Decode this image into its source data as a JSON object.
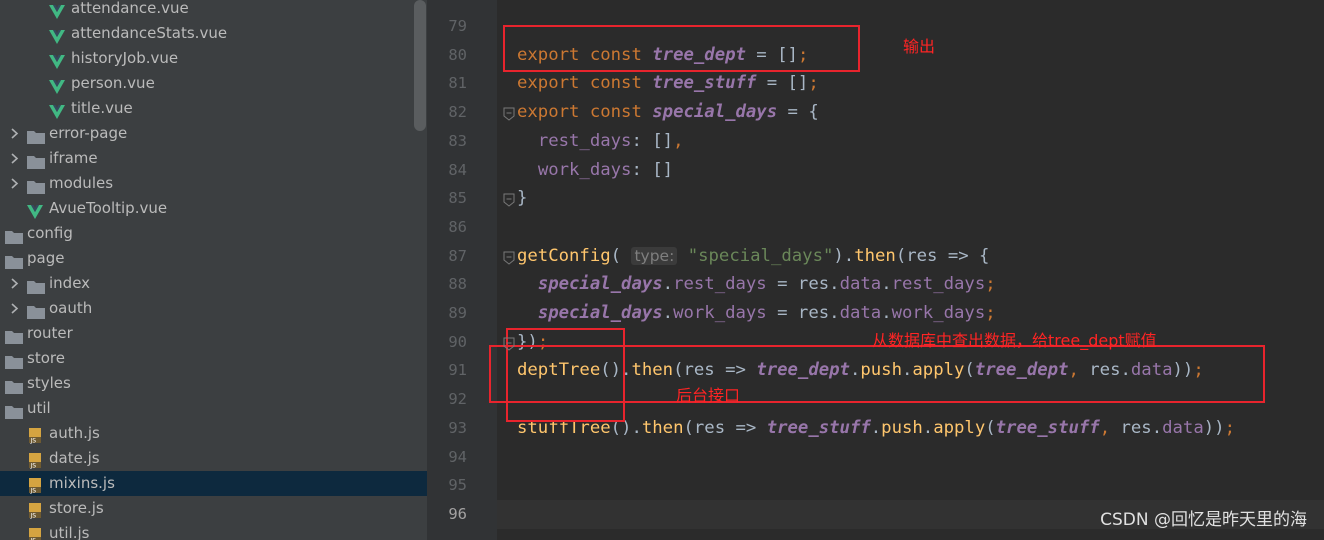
{
  "project_tree": {
    "items": [
      {
        "label": "attendance.vue",
        "kind": "vue-file",
        "depth": 2
      },
      {
        "label": "attendanceStats.vue",
        "kind": "vue-file",
        "depth": 2
      },
      {
        "label": "historyJob.vue",
        "kind": "vue-file",
        "depth": 2
      },
      {
        "label": "person.vue",
        "kind": "vue-file",
        "depth": 2
      },
      {
        "label": "title.vue",
        "kind": "vue-file",
        "depth": 2
      },
      {
        "label": "error-page",
        "kind": "folder",
        "depth": 1,
        "collapsed": true
      },
      {
        "label": "iframe",
        "kind": "folder",
        "depth": 1,
        "collapsed": true
      },
      {
        "label": "modules",
        "kind": "folder",
        "depth": 1,
        "collapsed": true
      },
      {
        "label": "AvueTooltip.vue",
        "kind": "vue-file",
        "depth": 1
      },
      {
        "label": "config",
        "kind": "folder",
        "depth": 0
      },
      {
        "label": "page",
        "kind": "folder",
        "depth": 0
      },
      {
        "label": "index",
        "kind": "folder",
        "depth": 1,
        "collapsed": true
      },
      {
        "label": "oauth",
        "kind": "folder",
        "depth": 1,
        "collapsed": true
      },
      {
        "label": "router",
        "kind": "folder",
        "depth": 0
      },
      {
        "label": "store",
        "kind": "folder",
        "depth": 0
      },
      {
        "label": "styles",
        "kind": "folder",
        "depth": 0
      },
      {
        "label": "util",
        "kind": "folder",
        "depth": 0
      },
      {
        "label": "auth.js",
        "kind": "js-file",
        "depth": 1
      },
      {
        "label": "date.js",
        "kind": "js-file",
        "depth": 1
      },
      {
        "label": "mixins.js",
        "kind": "js-file",
        "depth": 1,
        "selected": true
      },
      {
        "label": "store.js",
        "kind": "js-file",
        "depth": 1
      },
      {
        "label": "util.js",
        "kind": "js-file",
        "depth": 1
      }
    ]
  },
  "editor": {
    "current_line": "96",
    "lines": [
      {
        "num": "79",
        "tokens": []
      },
      {
        "num": "80",
        "tokens": [
          {
            "t": "export const ",
            "c": "kw"
          },
          {
            "t": "tree_dept",
            "c": "gv"
          },
          {
            "t": " = []",
            "c": ""
          },
          {
            "t": ";",
            "c": "kw"
          }
        ]
      },
      {
        "num": "81",
        "tokens": [
          {
            "t": "export const ",
            "c": "kw"
          },
          {
            "t": "tree_stuff",
            "c": "gv"
          },
          {
            "t": " = []",
            "c": ""
          },
          {
            "t": ";",
            "c": "kw"
          }
        ]
      },
      {
        "num": "82",
        "tokens": [
          {
            "t": "export const ",
            "c": "kw"
          },
          {
            "t": "special_days",
            "c": "gv"
          },
          {
            "t": " = {",
            "c": ""
          }
        ]
      },
      {
        "num": "83",
        "tokens": [
          {
            "t": "  ",
            "c": ""
          },
          {
            "t": "rest_days",
            "c": "prop"
          },
          {
            "t": ": []",
            "c": ""
          },
          {
            "t": ",",
            "c": "kw"
          }
        ]
      },
      {
        "num": "84",
        "tokens": [
          {
            "t": "  ",
            "c": ""
          },
          {
            "t": "work_days",
            "c": "prop"
          },
          {
            "t": ": []",
            "c": ""
          }
        ]
      },
      {
        "num": "85",
        "tokens": [
          {
            "t": "}",
            "c": ""
          }
        ]
      },
      {
        "num": "86",
        "tokens": []
      },
      {
        "num": "87",
        "tokens": [
          {
            "t": "getConfig",
            "c": "fn"
          },
          {
            "t": "( ",
            "c": ""
          },
          {
            "t": "type:",
            "c": "hint"
          },
          {
            "t": " ",
            "c": ""
          },
          {
            "t": "\"special_days\"",
            "c": "str"
          },
          {
            "t": ").",
            "c": ""
          },
          {
            "t": "then",
            "c": "fn"
          },
          {
            "t": "(res => {",
            "c": ""
          }
        ]
      },
      {
        "num": "88",
        "tokens": [
          {
            "t": "  ",
            "c": ""
          },
          {
            "t": "special_days",
            "c": "gv"
          },
          {
            "t": ".",
            "c": ""
          },
          {
            "t": "rest_days",
            "c": "prop"
          },
          {
            "t": " = res.",
            "c": ""
          },
          {
            "t": "data",
            "c": "prop"
          },
          {
            "t": ".",
            "c": ""
          },
          {
            "t": "rest_days",
            "c": "prop"
          },
          {
            "t": ";",
            "c": "kw"
          }
        ]
      },
      {
        "num": "89",
        "tokens": [
          {
            "t": "  ",
            "c": ""
          },
          {
            "t": "special_days",
            "c": "gv"
          },
          {
            "t": ".",
            "c": ""
          },
          {
            "t": "work_days",
            "c": "prop"
          },
          {
            "t": " = res.",
            "c": ""
          },
          {
            "t": "data",
            "c": "prop"
          },
          {
            "t": ".",
            "c": ""
          },
          {
            "t": "work_days",
            "c": "prop"
          },
          {
            "t": ";",
            "c": "kw"
          }
        ]
      },
      {
        "num": "90",
        "tokens": [
          {
            "t": "})",
            "c": ""
          },
          {
            "t": ";",
            "c": "kw"
          }
        ]
      },
      {
        "num": "91",
        "tokens": [
          {
            "t": "deptTree",
            "c": "fn"
          },
          {
            "t": "().",
            "c": ""
          },
          {
            "t": "then",
            "c": "fn"
          },
          {
            "t": "(res => ",
            "c": ""
          },
          {
            "t": "tree_dept",
            "c": "gv"
          },
          {
            "t": ".",
            "c": ""
          },
          {
            "t": "push",
            "c": "fn"
          },
          {
            "t": ".",
            "c": ""
          },
          {
            "t": "apply",
            "c": "fn"
          },
          {
            "t": "(",
            "c": ""
          },
          {
            "t": "tree_dept",
            "c": "gv"
          },
          {
            "t": ", ",
            "c": "kw"
          },
          {
            "t": "res.",
            "c": ""
          },
          {
            "t": "data",
            "c": "prop"
          },
          {
            "t": "))",
            "c": ""
          },
          {
            "t": ";",
            "c": "kw"
          }
        ]
      },
      {
        "num": "92",
        "tokens": []
      },
      {
        "num": "93",
        "tokens": [
          {
            "t": "stuffTree",
            "c": "fn"
          },
          {
            "t": "().",
            "c": ""
          },
          {
            "t": "then",
            "c": "fn"
          },
          {
            "t": "(res => ",
            "c": ""
          },
          {
            "t": "tree_stuff",
            "c": "gv"
          },
          {
            "t": ".",
            "c": ""
          },
          {
            "t": "push",
            "c": "fn"
          },
          {
            "t": ".",
            "c": ""
          },
          {
            "t": "apply",
            "c": "fn"
          },
          {
            "t": "(",
            "c": ""
          },
          {
            "t": "tree_stuff",
            "c": "gv"
          },
          {
            "t": ", ",
            "c": "kw"
          },
          {
            "t": "res.",
            "c": ""
          },
          {
            "t": "data",
            "c": "prop"
          },
          {
            "t": "))",
            "c": ""
          },
          {
            "t": ";",
            "c": "kw"
          }
        ]
      },
      {
        "num": "94",
        "tokens": []
      },
      {
        "num": "95",
        "tokens": []
      },
      {
        "num": "96",
        "tokens": []
      }
    ]
  },
  "annotations": {
    "output": "输出",
    "query": "从数据库中查出数据，给tree_dept赋值",
    "backend_api": "后台接口"
  },
  "watermark": "CSDN @回忆是昨天里的海",
  "colors": {
    "annotation_red": "#e8242d",
    "keyword": "#cc7832",
    "global_var": "#9876aa",
    "function": "#ffc66d",
    "string": "#6a8759",
    "vue_icon": "#41b883",
    "folder_icon": "#8a9199"
  }
}
